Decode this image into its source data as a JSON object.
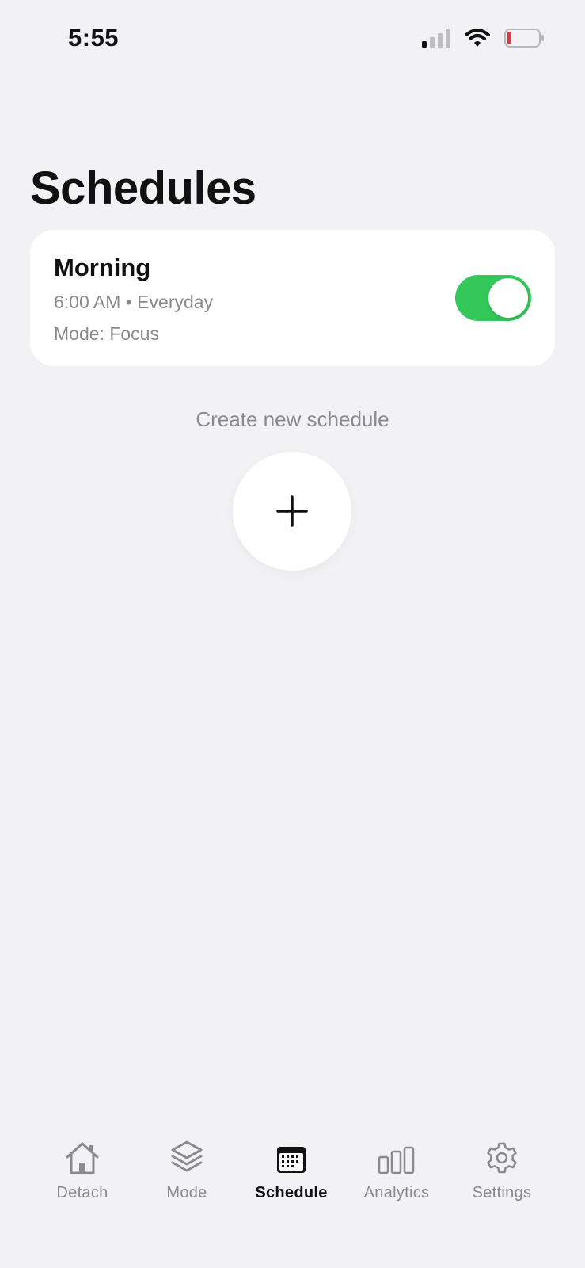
{
  "status_bar": {
    "time": "5:55",
    "signal_icon": "cellular-signal-icon",
    "wifi_icon": "wifi-icon",
    "battery_icon": "battery-low-icon",
    "battery_color": "#e5353b"
  },
  "page": {
    "title": "Schedules"
  },
  "schedules": [
    {
      "name": "Morning",
      "time_repeat": "6:00 AM • Everyday",
      "mode": "Mode: Focus",
      "enabled": true,
      "toggle_color": "#34c759"
    }
  ],
  "create": {
    "label": "Create new schedule",
    "icon": "plus-icon"
  },
  "tab_bar": {
    "items": [
      {
        "label": "Detach",
        "icon": "home-icon",
        "active": false
      },
      {
        "label": "Mode",
        "icon": "layers-icon",
        "active": false
      },
      {
        "label": "Schedule",
        "icon": "calendar-icon",
        "active": true
      },
      {
        "label": "Analytics",
        "icon": "bar-chart-icon",
        "active": false
      },
      {
        "label": "Settings",
        "icon": "gear-icon",
        "active": false
      }
    ]
  }
}
